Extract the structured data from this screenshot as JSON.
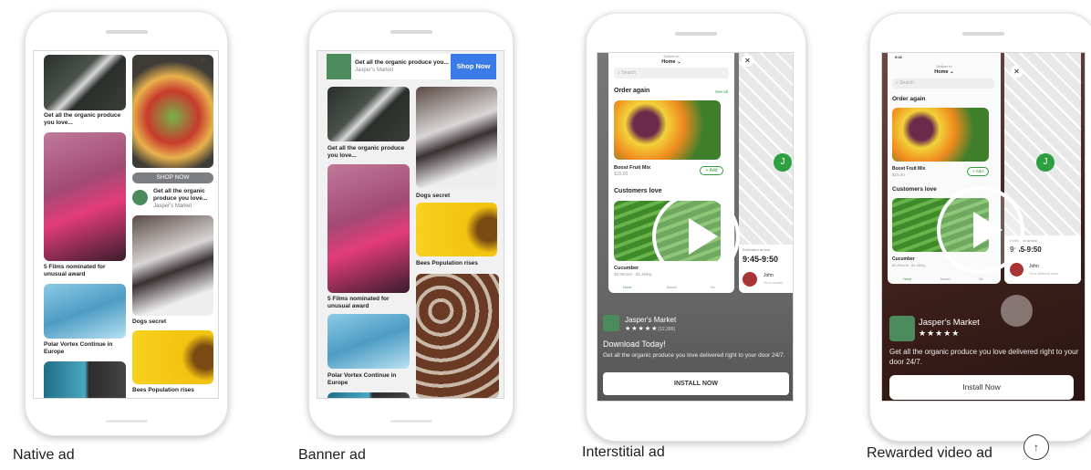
{
  "native": {
    "label": "Native ad",
    "captions": [
      "Get all the organic produce you love...",
      "5 Films nominated for unusual award",
      "Polar Vortex Continue in Europe",
      "Dogs secret",
      "Bees Population rises"
    ],
    "shop_now": "SHOP NOW",
    "ad_title": "Get all the organic produce you love...",
    "ad_advertiser": "Jasper's Market",
    "adchoice_icon": "play-triangle"
  },
  "banner": {
    "label": "Banner ad",
    "ad_title": "Get all the organic produce you...",
    "ad_advertiser": "Jasper's Market",
    "cta": "Shop Now",
    "cta_color": "#3b7be8",
    "captions": [
      "Get all the organic produce you love...",
      "5 Films nominated for unusual award",
      "Polar Vortex Continue in Europe",
      "Dogs secret",
      "Bees Population rises"
    ]
  },
  "interstitial": {
    "label": "Interstitial ad",
    "app": {
      "deliver_to": "Deliver to",
      "home": "Home ⌄",
      "search": "Search",
      "order_again": "Order again",
      "see_all": "See all",
      "item1": "Boost Fruit Mix",
      "price1": "$15.00",
      "add": "+ Add",
      "customers_love": "Customers love",
      "item2": "Cucumber",
      "price2": "$0.80/unit · $1.46/kg",
      "tabs": [
        "Home",
        "Basket",
        "Me"
      ],
      "eta_label": "Estimated arrival",
      "eta": "9:45-9:50",
      "courier": "John",
      "courier_role": "Your courier"
    },
    "advertiser": "Jasper's Market",
    "stars": "★★★★★",
    "rating_count": "(12,396)",
    "headline": "Download Today!",
    "body": "Get all the organic produce you love delivered right to your door 24/7.",
    "cta": "INSTALL NOW"
  },
  "rewarded": {
    "label": "Rewarded video ad",
    "app": {
      "time": "9:41",
      "deliver_to": "Deliver to",
      "home": "Home ⌄",
      "search": "Search",
      "order_again": "Order again",
      "item1": "Boost Fruit Mix",
      "price1": "$15.00",
      "add": "+ Add",
      "customers_love": "Customers love",
      "item2": "Cucumber",
      "price2": "$0.80/unit · $1.46/kg",
      "tabs": [
        "Home",
        "Basket",
        "Me"
      ],
      "eta_label": "Estimated arrival",
      "eta": "9:45-9:50",
      "courier": "John",
      "courier_role": "Your delivery man"
    },
    "advertiser": "Jasper's Market",
    "stars": "★★★★★",
    "body": "Get all the organic produce you love delivered right to your door 24/7.",
    "cta": "Install Now"
  },
  "colors": {
    "green": "#2e9e3e",
    "banner_blue": "#3b7be8"
  }
}
